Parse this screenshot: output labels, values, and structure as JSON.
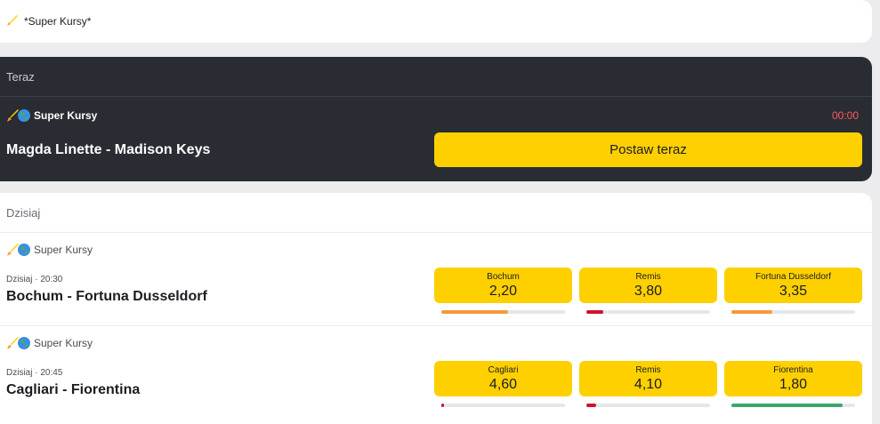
{
  "top": {
    "title": "*Super Kursy*"
  },
  "live": {
    "header": "Teraz",
    "badge": "Super Kursy",
    "timer": "00:00",
    "match": "Magda Linette - Madison Keys",
    "button_label": "Postaw teraz"
  },
  "today": {
    "header": "Dzisiaj",
    "events": [
      {
        "badge": "Super Kursy",
        "meta": "Dzisiaj · 20:30",
        "match": "Bochum - Fortuna Dusseldorf",
        "odds": [
          {
            "label": "Bochum",
            "value": "2,20",
            "share": 0.54,
            "color": "#f59a3c"
          },
          {
            "label": "Remis",
            "value": "3,80",
            "share": 0.14,
            "color": "#d0112b"
          },
          {
            "label": "Fortuna Dusseldorf",
            "value": "3,35",
            "share": 0.33,
            "color": "#f59a3c"
          }
        ]
      },
      {
        "badge": "Super Kursy",
        "meta": "Dzisiaj · 20:45",
        "match": "Cagliari - Fiorentina",
        "odds": [
          {
            "label": "Cagliari",
            "value": "4,60",
            "share": 0.02,
            "color": "#d0112b"
          },
          {
            "label": "Remis",
            "value": "4,10",
            "share": 0.08,
            "color": "#d0112b"
          },
          {
            "label": "Fiorentina",
            "value": "1,80",
            "share": 0.9,
            "color": "#3aa76d"
          }
        ]
      }
    ]
  },
  "colors": {
    "accent": "#ffd000",
    "live_bg": "#2a2c33",
    "timer": "#ff5a5a"
  }
}
